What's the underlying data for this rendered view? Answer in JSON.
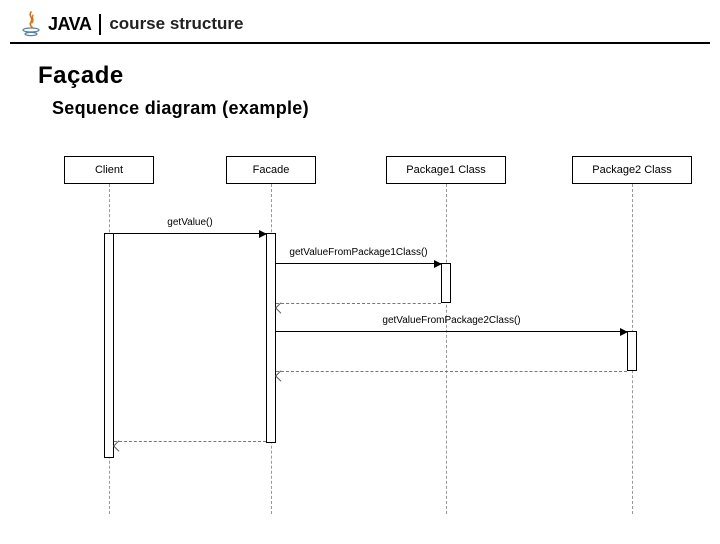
{
  "header": {
    "logo_alt": "java-cup",
    "java_label": "JAVA",
    "course_label": "course structure"
  },
  "slide": {
    "title": "Façade",
    "subtitle": "Sequence diagram (example)"
  },
  "participants": [
    {
      "id": "client",
      "label": "Client"
    },
    {
      "id": "facade",
      "label": "Facade"
    },
    {
      "id": "pkg1",
      "label": "Package1 Class"
    },
    {
      "id": "pkg2",
      "label": "Package2 Class"
    }
  ],
  "messages": {
    "m1": "getValue()",
    "m2": "getValueFromPackage1Class()",
    "m3": "getValueFromPackage2Class()"
  }
}
